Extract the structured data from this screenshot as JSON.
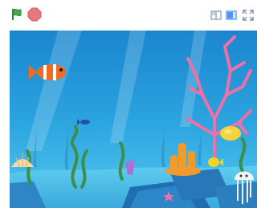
{
  "toolbar": {
    "icons": {
      "green_flag": "green-flag-icon",
      "stop": "stop-icon",
      "small_stage": "small-stage-layout-icon",
      "large_stage": "large-stage-layout-icon",
      "fullscreen": "fullscreen-icon"
    }
  },
  "stage": {
    "scene": "underwater",
    "colors": {
      "water_top": "#1f8fd6",
      "water_bottom": "#4bc3ec",
      "seabed": "#3fb1de",
      "coral_pink": "#f06fa6",
      "clownfish": "#f26a21",
      "seaweed": "#3a8f4a",
      "accent_flag": "#3cb043",
      "stop": "#e7777b"
    }
  }
}
